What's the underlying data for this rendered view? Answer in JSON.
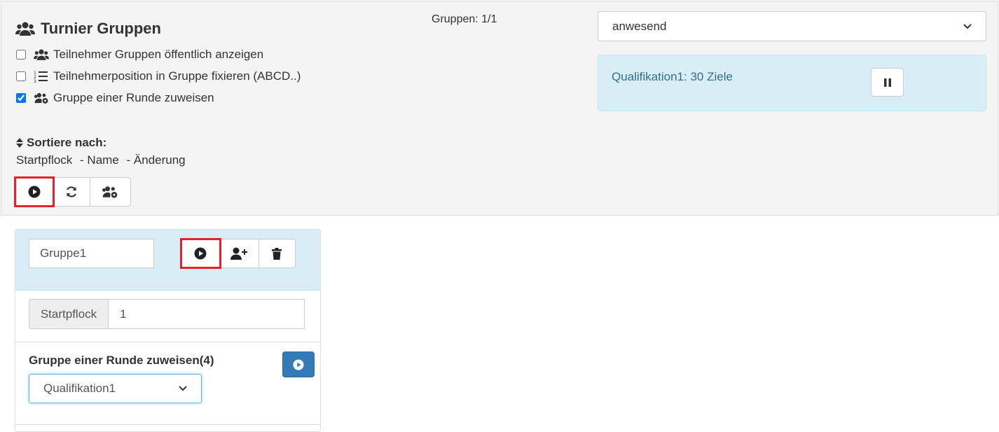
{
  "header": {
    "title": "Turnier Gruppen",
    "groups_count": "Gruppen: 1/1"
  },
  "options": [
    {
      "label": "Teilnehmer Gruppen öffentlich anzeigen",
      "checked": false
    },
    {
      "label": "Teilnehmerposition in Gruppe fixieren (ABCD..)",
      "checked": false
    },
    {
      "label": "Gruppe einer Runde zuweisen",
      "checked": true
    }
  ],
  "status_select": {
    "value": "anwesend"
  },
  "round_info": {
    "text": "Qualifikation1: 30 Ziele"
  },
  "sort": {
    "label": "Sortiere nach:",
    "links": [
      "Startpflock",
      "- Name",
      "- Änderung"
    ]
  },
  "group": {
    "name": "Gruppe1",
    "startpflock_label": "Startpflock",
    "startpflock_value": "1",
    "assign_title": "Gruppe einer Runde zuweisen(4)",
    "round_select_value": "Qualifikation1"
  },
  "colors": {
    "highlight": "#e8202a",
    "info_bg": "#d9edf7",
    "primary": "#337ab7"
  }
}
